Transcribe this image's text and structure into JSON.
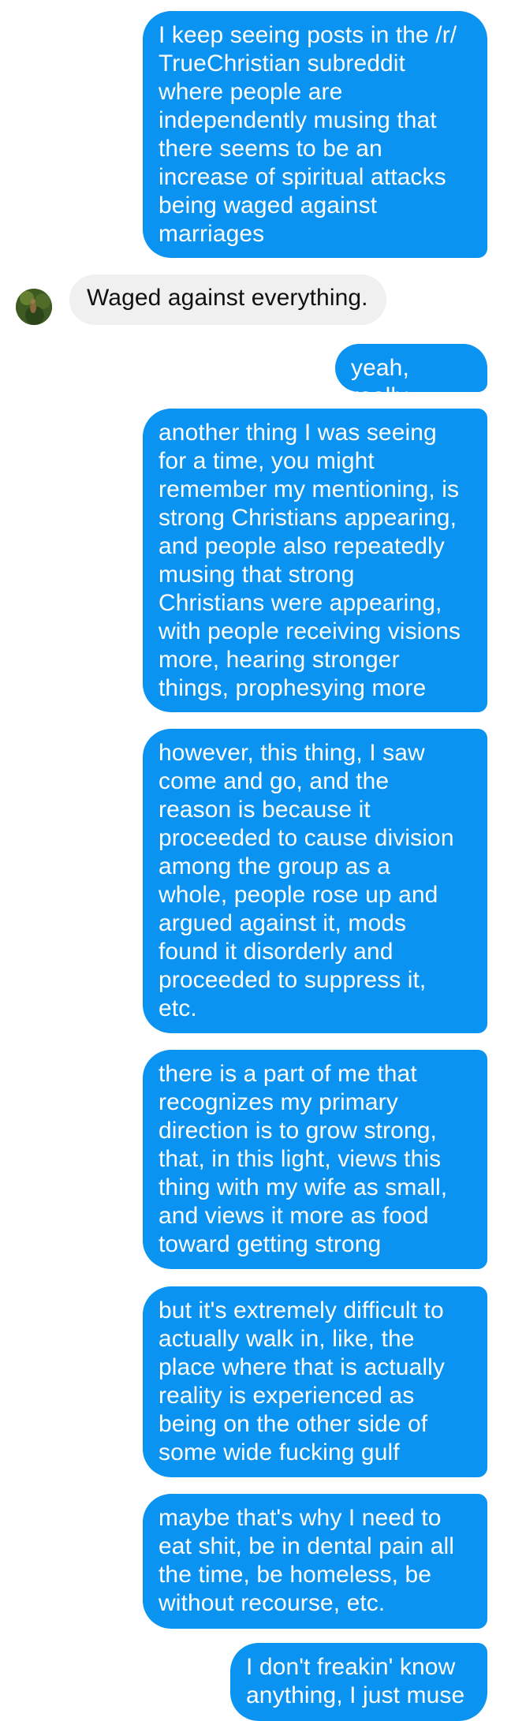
{
  "colors": {
    "outgoing_bubble": "#0a93f0",
    "incoming_bubble": "#f0f0f0"
  },
  "incoming_avatar": {
    "icon": "contact-avatar-photo"
  },
  "messages": [
    {
      "sender": "me",
      "text": "I keep seeing posts in the /r/\nTrueChristian subreddit\nwhere people are\nindependently musing that\nthere seems to be an\nincrease of spiritual attacks\nbeing waged against\nmarriages"
    },
    {
      "sender": "other",
      "text": "Waged against everything."
    },
    {
      "sender": "me",
      "text": "yeah, really"
    },
    {
      "sender": "me",
      "text": "another thing I was seeing\nfor a time, you might\nremember my mentioning, is\nstrong Christians appearing,\nand people also repeatedly\nmusing that strong\nChristians were appearing,\nwith people receiving visions\nmore, hearing stronger\nthings, prophesying more"
    },
    {
      "sender": "me",
      "text": "however, this thing, I saw\ncome and go, and the\nreason is because it\nproceeded to cause division\namong the group as a\nwhole, people rose up and\nargued against it, mods\nfound it disorderly and\nproceeded to suppress it,\netc."
    },
    {
      "sender": "me",
      "text": "there is a part of me that\nrecognizes my primary\ndirection is to grow strong,\nthat, in this light, views this\nthing with my wife as small,\nand views it more as food\ntoward getting strong"
    },
    {
      "sender": "me",
      "text": "but it's extremely difficult to\nactually walk in, like, the\nplace where that is actually\nreality is experienced as\nbeing on the other side of\nsome wide fucking gulf"
    },
    {
      "sender": "me",
      "text": "maybe that's why I need to\neat shit, be in dental pain all\nthe time, be homeless, be\nwithout recourse, etc."
    },
    {
      "sender": "me",
      "text": "I don't freakin' know\nanything, I just muse"
    }
  ]
}
